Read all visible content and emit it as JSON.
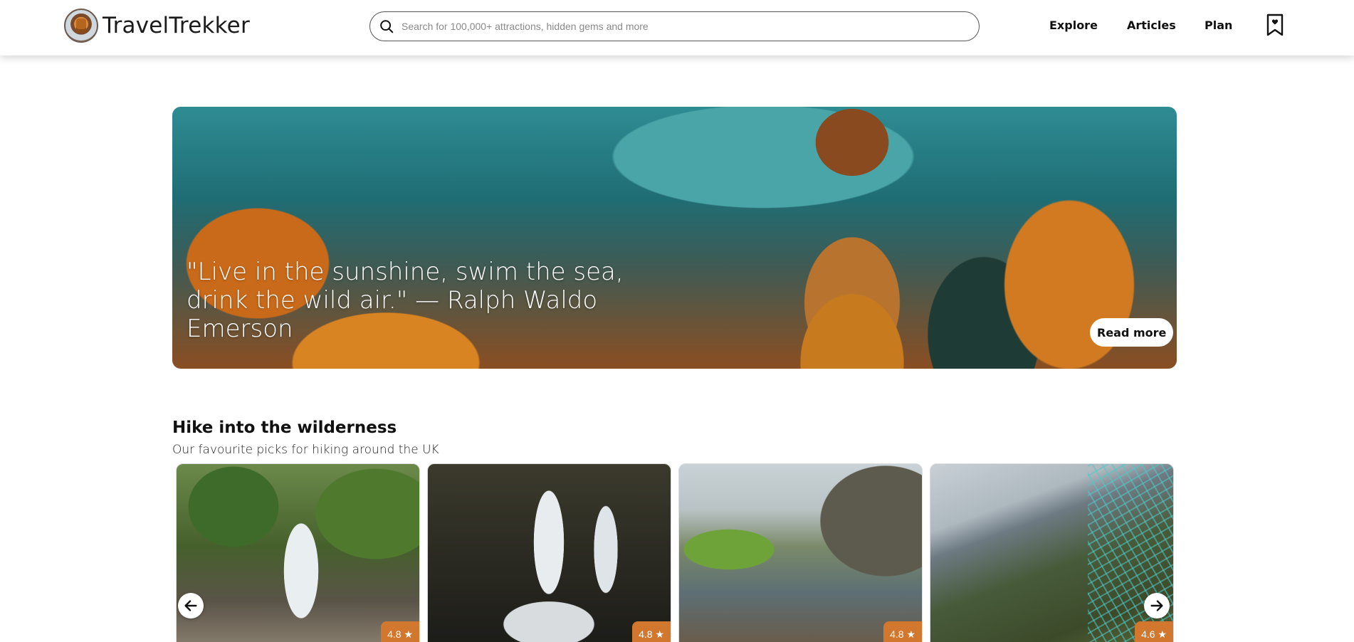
{
  "header": {
    "brand": "TravelTrekker",
    "search_placeholder": "Search for 100,000+ attractions, hidden gems and more",
    "nav": [
      {
        "label": "Explore"
      },
      {
        "label": "Articles"
      },
      {
        "label": "Plan"
      }
    ],
    "bookmark_icon": "bookmark-heart-icon"
  },
  "hero": {
    "quote": "\"Live in the sunshine, swim the sea, drink the wild air.\" — Ralph Waldo Emerson",
    "read_more_label": "Read more"
  },
  "section": {
    "title": "Hike into the wilderness",
    "subtitle": "Our favourite picks for hiking around the UK"
  },
  "cards": [
    {
      "rating": "4.8 ★"
    },
    {
      "rating": "4.8 ★"
    },
    {
      "rating": "4.8 ★"
    },
    {
      "rating": "4.6 ★"
    }
  ],
  "carousel": {
    "prev_icon": "arrow-left-icon",
    "next_icon": "arrow-right-icon"
  },
  "colors": {
    "accent": "#d2772e",
    "text": "#111111"
  }
}
